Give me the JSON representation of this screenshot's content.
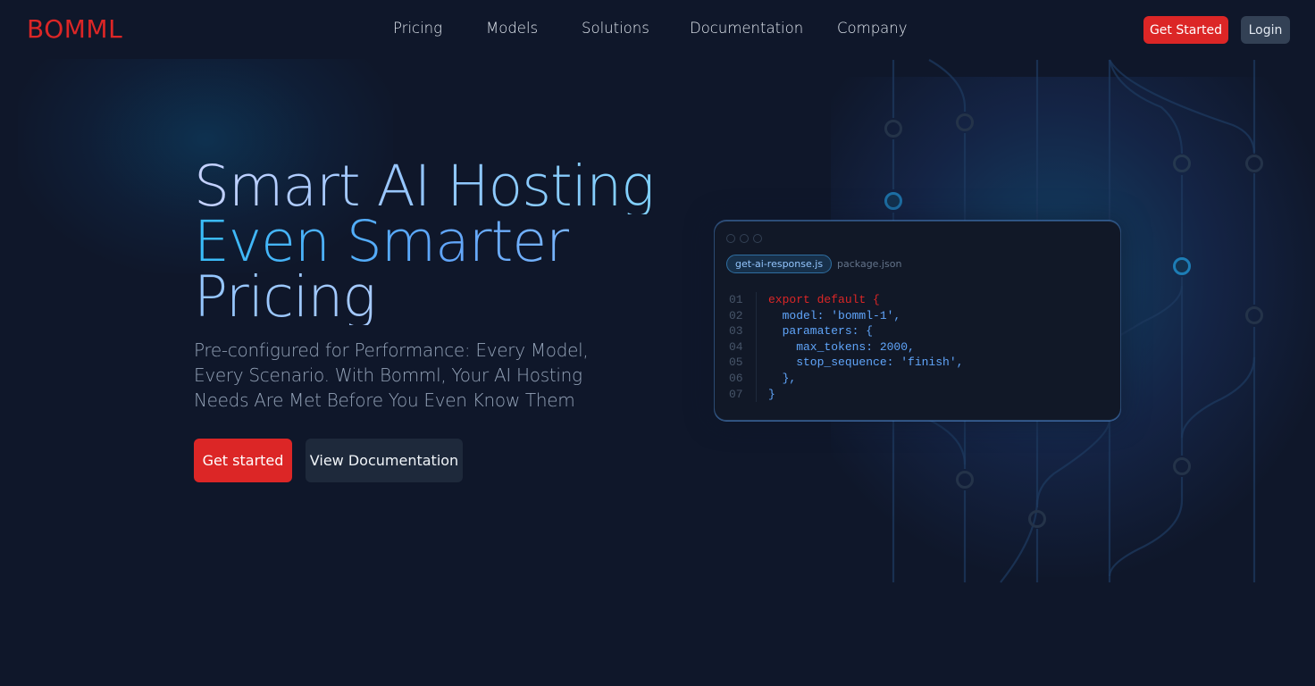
{
  "brand": {
    "logo": "BOMML",
    "accent": "#dc2626"
  },
  "nav": {
    "items": [
      {
        "label": "Pricing"
      },
      {
        "label": "Models"
      },
      {
        "label": "Solutions"
      },
      {
        "label": "Documentation"
      },
      {
        "label": "Company"
      }
    ],
    "get_started_label": "Get Started",
    "login_label": "Login"
  },
  "hero": {
    "title_lines": [
      "Smart AI Hosting",
      "Even Smarter",
      "Pricing"
    ],
    "subtitle": "Pre-configured for Performance: Every Model, Every Scenario. With Bomml, Your AI Hosting Needs Are Met Before You Even Know Them",
    "cta_primary": "Get started",
    "cta_secondary": "View Documentation"
  },
  "code_panel": {
    "tabs": [
      {
        "label": "get-ai-response.js",
        "active": true
      },
      {
        "label": "package.json",
        "active": false
      }
    ],
    "lines": [
      {
        "num": "01",
        "text": "export default {",
        "style": "kw"
      },
      {
        "num": "02",
        "text": "  model: 'bomml-1',",
        "style": "key"
      },
      {
        "num": "03",
        "text": "  paramaters: {",
        "style": "key"
      },
      {
        "num": "04",
        "text": "    max_tokens: 2000,",
        "style": "key"
      },
      {
        "num": "05",
        "text": "    stop_sequence: 'finish',",
        "style": "key"
      },
      {
        "num": "06",
        "text": "  },",
        "style": "key"
      },
      {
        "num": "07",
        "text": "}",
        "style": "key"
      }
    ]
  }
}
